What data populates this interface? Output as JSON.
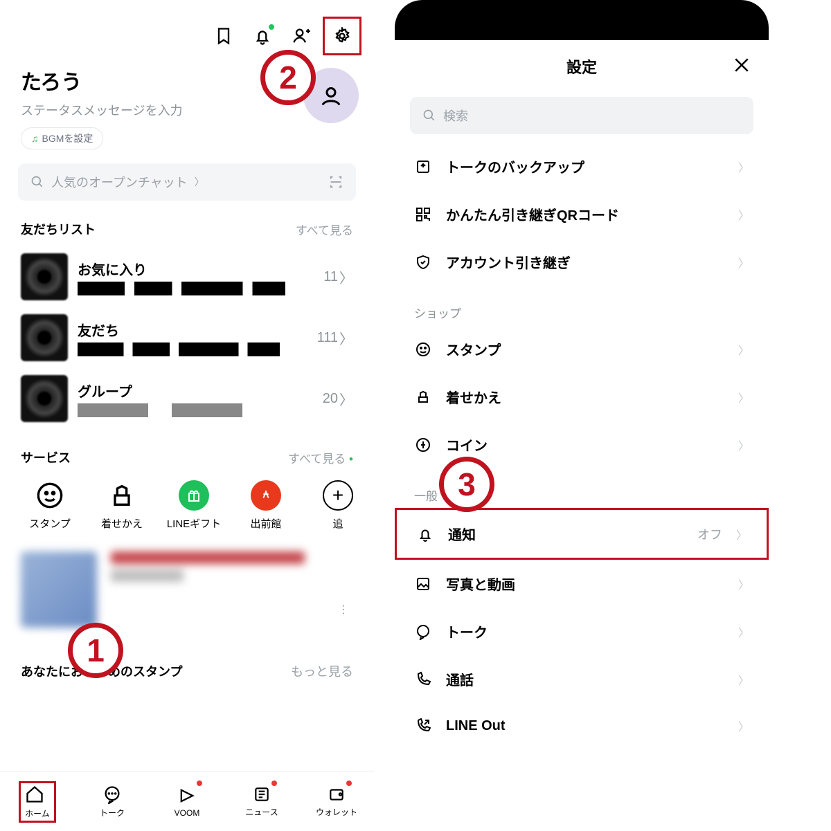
{
  "callouts": {
    "one": "1",
    "two": "2",
    "three": "3"
  },
  "left": {
    "profile": {
      "name": "たろう",
      "status": "ステータスメッセージを入力",
      "bgm": "BGMを設定"
    },
    "search": {
      "placeholder": "人気のオープンチャット"
    },
    "friends": {
      "title": "友だちリスト",
      "more": "すべて見る",
      "items": [
        {
          "name": "お気に入り",
          "count": "11"
        },
        {
          "name": "友だち",
          "count": "111"
        },
        {
          "name": "グループ",
          "count": "20"
        }
      ]
    },
    "services": {
      "title": "サービス",
      "more": "すべて見る",
      "items": [
        {
          "label": "スタンプ"
        },
        {
          "label": "着せかえ"
        },
        {
          "label": "LINEギフト"
        },
        {
          "label": "出前館"
        },
        {
          "label": "追"
        }
      ]
    },
    "stickers": {
      "title": "あなたにおすすめのスタンプ",
      "more": "もっと見る"
    },
    "tabs": [
      {
        "label": "ホーム"
      },
      {
        "label": "トーク"
      },
      {
        "label": "VOOM"
      },
      {
        "label": "ニュース"
      },
      {
        "label": "ウォレット"
      }
    ]
  },
  "right": {
    "title": "設定",
    "search": "検索",
    "sections": {
      "top": [
        {
          "label": "トークのバックアップ"
        },
        {
          "label": "かんたん引き継ぎQRコード"
        },
        {
          "label": "アカウント引き継ぎ"
        }
      ],
      "shop_title": "ショップ",
      "shop": [
        {
          "label": "スタンプ"
        },
        {
          "label": "着せかえ"
        },
        {
          "label": "コイン"
        }
      ],
      "general_title": "一般",
      "general": [
        {
          "label": "通知",
          "value": "オフ"
        },
        {
          "label": "写真と動画"
        },
        {
          "label": "トーク"
        },
        {
          "label": "通話"
        },
        {
          "label": "LINE Out"
        }
      ]
    }
  }
}
